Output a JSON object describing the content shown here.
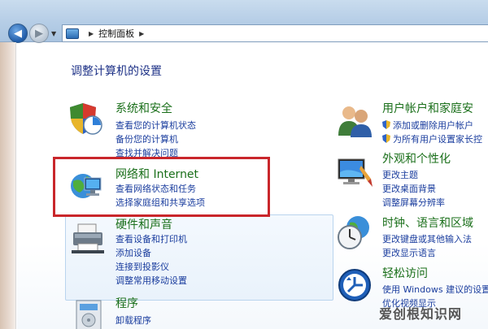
{
  "address_bar": {
    "breadcrumb": [
      "控制面板"
    ]
  },
  "page_title": "调整计算机的设置",
  "categories": {
    "system_security": {
      "title": "系统和安全",
      "links": [
        "查看您的计算机状态",
        "备份您的计算机",
        "查找并解决问题"
      ]
    },
    "network": {
      "title": "网络和 Internet",
      "links": [
        "查看网络状态和任务",
        "选择家庭组和共享选项"
      ]
    },
    "hardware": {
      "title": "硬件和声音",
      "links": [
        "查看设备和打印机",
        "添加设备",
        "连接到投影仪",
        "调整常用移动设置"
      ]
    },
    "programs": {
      "title": "程序",
      "links": [
        "卸载程序"
      ]
    },
    "accounts": {
      "title": "用户帐户和家庭安",
      "links": [
        "添加或删除用户帐户",
        "为所有用户设置家长控"
      ]
    },
    "appearance": {
      "title": "外观和个性化",
      "links": [
        "更改主题",
        "更改桌面背景",
        "调整屏幕分辨率"
      ]
    },
    "clock": {
      "title": "时钟、语言和区域",
      "links": [
        "更改键盘或其他输入法",
        "更改显示语言"
      ]
    },
    "ease": {
      "title": "轻松访问",
      "links": [
        "使用 Windows 建议的设置",
        "优化视频显示"
      ]
    }
  },
  "watermark": "爱创根知识网",
  "colors": {
    "category_title": "#1a6f1a",
    "link": "#1a3d9e",
    "highlight_border": "#c9262b",
    "page_title": "#1e3287"
  }
}
